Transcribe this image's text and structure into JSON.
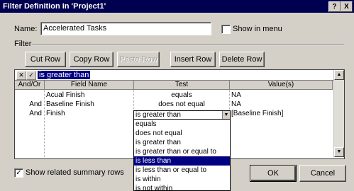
{
  "window": {
    "title": "Filter Definition in 'Project1'",
    "help_label": "?",
    "close_label": "X"
  },
  "name": {
    "label": "Name:",
    "value": "Accelerated Tasks"
  },
  "show_in_menu": {
    "label": "Show in menu",
    "checked": false
  },
  "filter_label": "Filter",
  "toolbar": {
    "cut_row": "Cut Row",
    "copy_row": "Copy Row",
    "paste_row": "Paste Row",
    "insert_row": "Insert Row",
    "delete_row": "Delete Row"
  },
  "edit_bar": {
    "cancel_glyph": "✕",
    "accept_glyph": "✓",
    "value": "is greater than"
  },
  "columns": [
    "And/Or",
    "Field Name",
    "Test",
    "Value(s)"
  ],
  "rows": [
    {
      "andor": "",
      "field": "Acual Finish",
      "test": "equals",
      "value": "NA"
    },
    {
      "andor": "And",
      "field": "Baseline Finish",
      "test": "does not equal",
      "value": "NA"
    },
    {
      "andor": "And",
      "field": "Finish",
      "test": "is greater than",
      "value": "[Baseline Finish]"
    }
  ],
  "dropdown_options": [
    "equals",
    "does not equal",
    "is greater than",
    "is greater than or equal to",
    "is less than",
    "is less than or equal to",
    "is within",
    "is not within"
  ],
  "dropdown_selected": "is less than",
  "show_summary": {
    "label": "Show related summary rows",
    "checked": true,
    "check_glyph": "✓"
  },
  "buttons": {
    "ok": "OK",
    "cancel": "Cancel"
  }
}
